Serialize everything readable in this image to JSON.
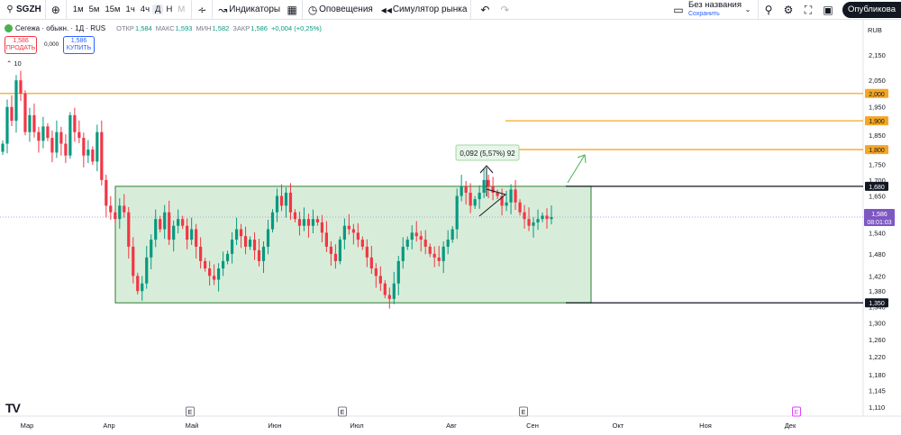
{
  "toolbar": {
    "symbol": "SGZH",
    "timeframes": [
      "1м",
      "5м",
      "15м",
      "1ч",
      "4ч",
      "Д",
      "Н",
      "М"
    ],
    "active_timeframe": "Д",
    "indicators_label": "Индикаторы",
    "alerts_label": "Оповещения",
    "replay_label": "Симулятор рынка",
    "layout_title": "Без названия",
    "layout_status": "Сохранить",
    "publish_label": "Опубликова"
  },
  "legend": {
    "name": "Сегежа · обыкн. · 1Д · RUS",
    "open_label": "ОТКР",
    "open": "1,584",
    "high_label": "МАКС",
    "high": "1,593",
    "low_label": "МИН",
    "low": "1,582",
    "close_label": "ЗАКР",
    "close": "1,586",
    "change": "+0,004 (+0,25%)"
  },
  "trade": {
    "sell_price": "1,586",
    "sell_label": "ПРОДАТЬ",
    "spread": "0,000",
    "buy_price": "1,586",
    "buy_label": "КУПИТЬ"
  },
  "indicator_count": "10",
  "currency": "RUB",
  "colors": {
    "up": "#089981",
    "down": "#f23645",
    "orange": "#f5a623",
    "range_fill": "#4caf50",
    "price_badge": "#7e57c2",
    "purple_line": "#b39ddb"
  },
  "chart_data": {
    "type": "candlestick",
    "y_scale": "log",
    "y_ticks": [
      "2,150",
      "2,050",
      "1,950",
      "1,850",
      "1,750",
      "1,700",
      "1,650",
      "1,600",
      "1,540",
      "1,480",
      "1,420",
      "1,380",
      "1,340",
      "1,300",
      "1,260",
      "1,220",
      "1,180",
      "1,145",
      "1,110"
    ],
    "x_labels": [
      "Мар",
      "Апр",
      "Май",
      "Июн",
      "Июл",
      "Авг",
      "Сен",
      "Окт",
      "Ноя",
      "Дек"
    ],
    "last_price": "1,586",
    "countdown": "08:01:03",
    "levels": [
      {
        "value": 2.0,
        "label": "2,000",
        "color": "orange"
      },
      {
        "value": 1.9,
        "label": "1,900",
        "color": "orange"
      },
      {
        "value": 1.8,
        "label": "1,800",
        "color": "orange"
      },
      {
        "value": 1.68,
        "label": "1,680",
        "color": "black"
      },
      {
        "value": 1.35,
        "label": "1,350",
        "color": "black"
      }
    ],
    "range_box": {
      "top": 1.68,
      "bottom": 1.35
    },
    "measure_label": "0,092 (5,57%) 92",
    "earnings_markers": [
      "E",
      "E",
      "E",
      "E"
    ],
    "closes": [
      1.82,
      1.95,
      1.9,
      2.05,
      2.0,
      1.86,
      1.92,
      1.86,
      1.83,
      1.88,
      1.84,
      1.79,
      1.86,
      1.82,
      1.78,
      1.92,
      1.86,
      1.84,
      1.78,
      1.8,
      1.76,
      1.86,
      1.7,
      1.62,
      1.6,
      1.58,
      1.62,
      1.6,
      1.5,
      1.42,
      1.38,
      1.4,
      1.47,
      1.52,
      1.58,
      1.55,
      1.6,
      1.52,
      1.56,
      1.58,
      1.56,
      1.52,
      1.55,
      1.5,
      1.46,
      1.44,
      1.42,
      1.41,
      1.44,
      1.46,
      1.48,
      1.52,
      1.55,
      1.53,
      1.5,
      1.52,
      1.49,
      1.46,
      1.5,
      1.55,
      1.6,
      1.65,
      1.62,
      1.66,
      1.6,
      1.58,
      1.56,
      1.58,
      1.56,
      1.58,
      1.57,
      1.54,
      1.5,
      1.48,
      1.46,
      1.52,
      1.56,
      1.55,
      1.54,
      1.52,
      1.5,
      1.47,
      1.44,
      1.42,
      1.4,
      1.37,
      1.36,
      1.4,
      1.46,
      1.5,
      1.52,
      1.54,
      1.53,
      1.52,
      1.5,
      1.48,
      1.47,
      1.46,
      1.5,
      1.52,
      1.55,
      1.65,
      1.68,
      1.66,
      1.62,
      1.64,
      1.66,
      1.7,
      1.68,
      1.66,
      1.65,
      1.62,
      1.63,
      1.67,
      1.63,
      1.6,
      1.58,
      1.56,
      1.57,
      1.58,
      1.59,
      1.58,
      1.586
    ]
  }
}
